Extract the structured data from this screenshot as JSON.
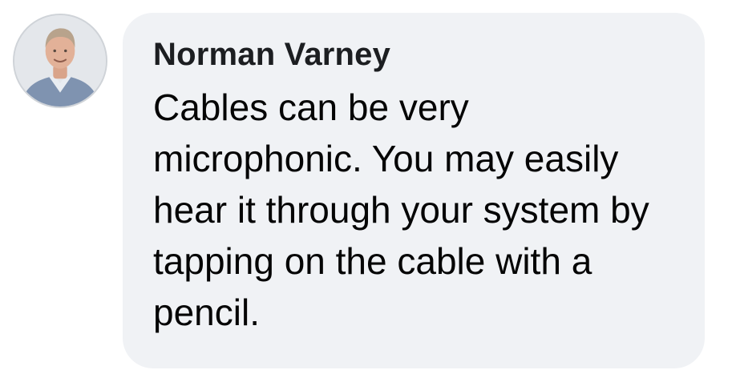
{
  "comment": {
    "author": "Norman Varney",
    "text": "Cables can be very microphonic. You may easily hear it through your system by tapping on the cable with a pencil.",
    "avatar_icon": "profile-photo"
  },
  "colors": {
    "bubble_background": "#f0f2f5",
    "author_text": "#1c1e21",
    "body_text": "#050505",
    "page_background": "#ffffff"
  }
}
